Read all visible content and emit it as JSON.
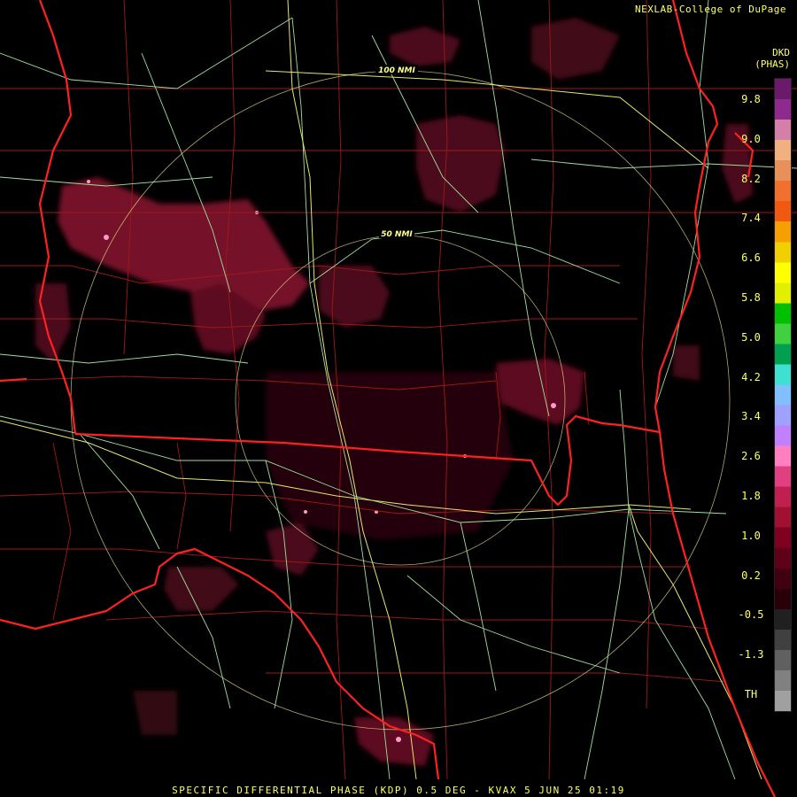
{
  "credit": "NEXLAB-College of DuPage",
  "units": {
    "line1": "DKD",
    "line2": "(PHAS)"
  },
  "rings": [
    {
      "label": "100 NMI"
    },
    {
      "label": "50 NMI"
    }
  ],
  "legend": {
    "labels": [
      "9.8",
      "9.0",
      "8.2",
      "7.4",
      "6.6",
      "5.8",
      "5.0",
      "4.2",
      "3.4",
      "2.6",
      "1.8",
      "1.0",
      "0.2",
      "-0.5",
      "-1.3",
      "TH"
    ],
    "colors": [
      "#6b1a6b",
      "#8e2a8e",
      "#d47fa8",
      "#f0b080",
      "#e8905a",
      "#f07030",
      "#f05a10",
      "#f5a000",
      "#f0d000",
      "#ffff00",
      "#e0f000",
      "#00c000",
      "#40d040",
      "#00a050",
      "#40e0d0",
      "#80c0ff",
      "#a0a0ff",
      "#c080ff",
      "#ff80c0",
      "#e04080",
      "#c02050",
      "#a01030",
      "#800020",
      "#600018",
      "#400010",
      "#2a0008",
      "#202020",
      "#404040",
      "#606060",
      "#808080",
      "#a0a0a0"
    ]
  },
  "caption": "SPECIFIC DIFFERENTIAL PHASE (KDP) 0.5 DEG - KVAX 5 JUN 25 01:19"
}
